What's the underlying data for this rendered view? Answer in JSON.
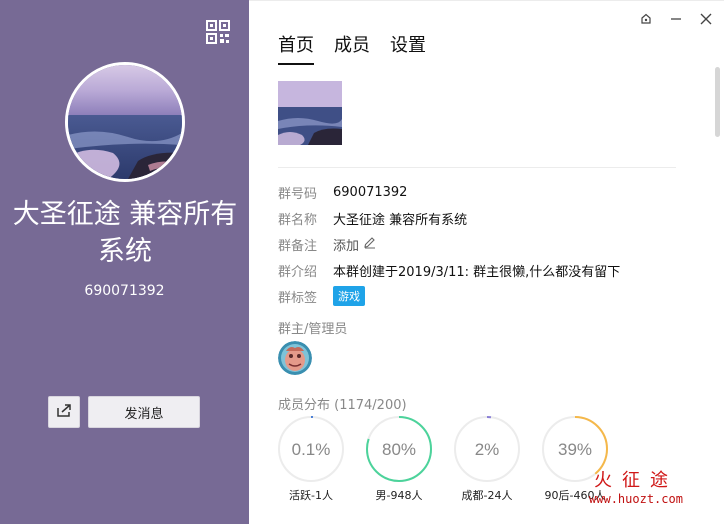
{
  "left_panel": {
    "group_name": "大圣征途 兼容所有系统",
    "group_id": "690071392",
    "send_message_label": "发消息"
  },
  "tabs": [
    {
      "label": "首页",
      "active": true
    },
    {
      "label": "成员",
      "active": false
    },
    {
      "label": "设置",
      "active": false
    }
  ],
  "info": {
    "rows": [
      {
        "label": "群号码",
        "value": "690071392"
      },
      {
        "label": "群名称",
        "value": "大圣征途 兼容所有系统"
      },
      {
        "label": "群备注",
        "value": "添加"
      },
      {
        "label": "群介绍",
        "value": "本群创建于2019/3/11:  群主很懒,什么都没有留下"
      },
      {
        "label": "群标签",
        "value": "游戏"
      }
    ]
  },
  "admins": {
    "title": "群主/管理员"
  },
  "distribution": {
    "title": "成员分布 (1174/200)",
    "stats": [
      {
        "value": "0.1%",
        "label": "活跃-1人",
        "fraction": 0.001,
        "color": "#4a7fd6"
      },
      {
        "value": "80%",
        "label": "男-948人",
        "fraction": 0.8,
        "color": "#4cd39b"
      },
      {
        "value": "2%",
        "label": "成都-24人",
        "fraction": 0.02,
        "color": "#8a7fd6"
      },
      {
        "value": "39%",
        "label": "90后-460人",
        "fraction": 0.39,
        "color": "#f5b84a"
      }
    ]
  },
  "watermark": {
    "line1": "火征途",
    "line2": "www.huozt.com"
  },
  "colors": {
    "left_bg": "#776a95",
    "tag_bg": "#1fa3e8"
  }
}
